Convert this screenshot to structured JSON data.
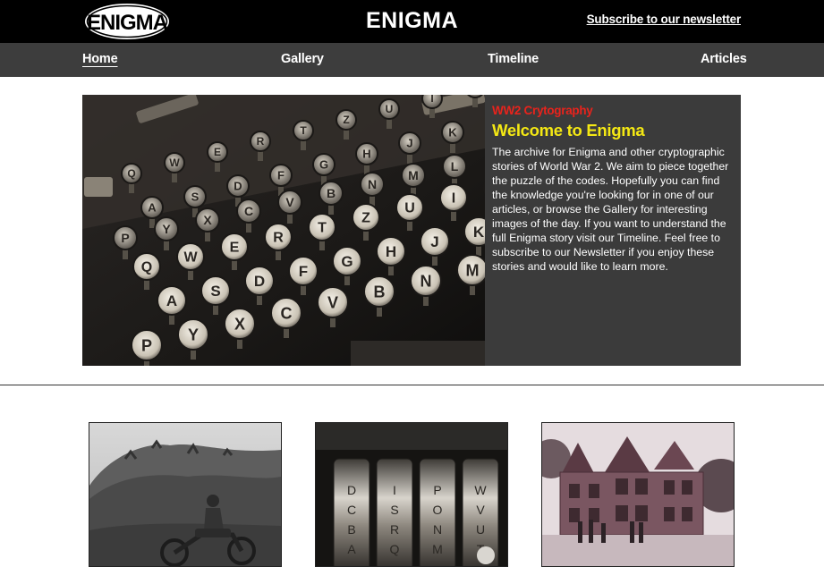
{
  "header": {
    "logo_text": "ENIGMA",
    "title": "ENIGMA",
    "newsletter_link": "Subscribe to our newsletter"
  },
  "nav": {
    "items": [
      {
        "label": "Home",
        "active": true
      },
      {
        "label": "Gallery",
        "active": false
      },
      {
        "label": "Timeline",
        "active": false
      },
      {
        "label": "Articles",
        "active": false
      }
    ]
  },
  "hero": {
    "kicker": "WW2 Crytography",
    "heading": "Welcome to Enigma",
    "body": "The archive for Enigma and other cryptographic stories of World War 2. We aim to piece together the puzzle of the codes. Hopefully you can find the knowledge you're looking for in one of our articles, or browse the Gallery for interesting images of the day. If you want to understand the full Enigma story visit our Timeline. Feel free to subscribe to our Newsletter if you enjoy these stories and would like to learn more.",
    "image_icon": "enigma-keyboard-photo",
    "keyboard_rows": [
      [
        "Q",
        "W",
        "E",
        "R",
        "T",
        "Z",
        "U",
        "I",
        "O"
      ],
      [
        "A",
        "S",
        "D",
        "F",
        "G",
        "H",
        "J",
        "K"
      ],
      [
        "P",
        "Y",
        "X",
        "C",
        "V",
        "B",
        "N",
        "M",
        "L"
      ]
    ]
  },
  "cards": [
    {
      "icon": "motorcycle-soldier-photo"
    },
    {
      "icon": "enigma-rotors-photo",
      "rotor_letters": [
        "D",
        "C",
        "B",
        "A",
        "I",
        "S",
        "R",
        "Q",
        "P",
        "O",
        "N",
        "M",
        "W",
        "V",
        "U",
        "T"
      ]
    },
    {
      "icon": "bletchley-park-photo"
    }
  ],
  "colors": {
    "header_bg": "#000000",
    "nav_bg": "#3d3d3d",
    "hero_bg": "#3b3b3b",
    "kicker": "#e8231c",
    "heading": "#f4e814",
    "body_text": "#ffffff"
  }
}
